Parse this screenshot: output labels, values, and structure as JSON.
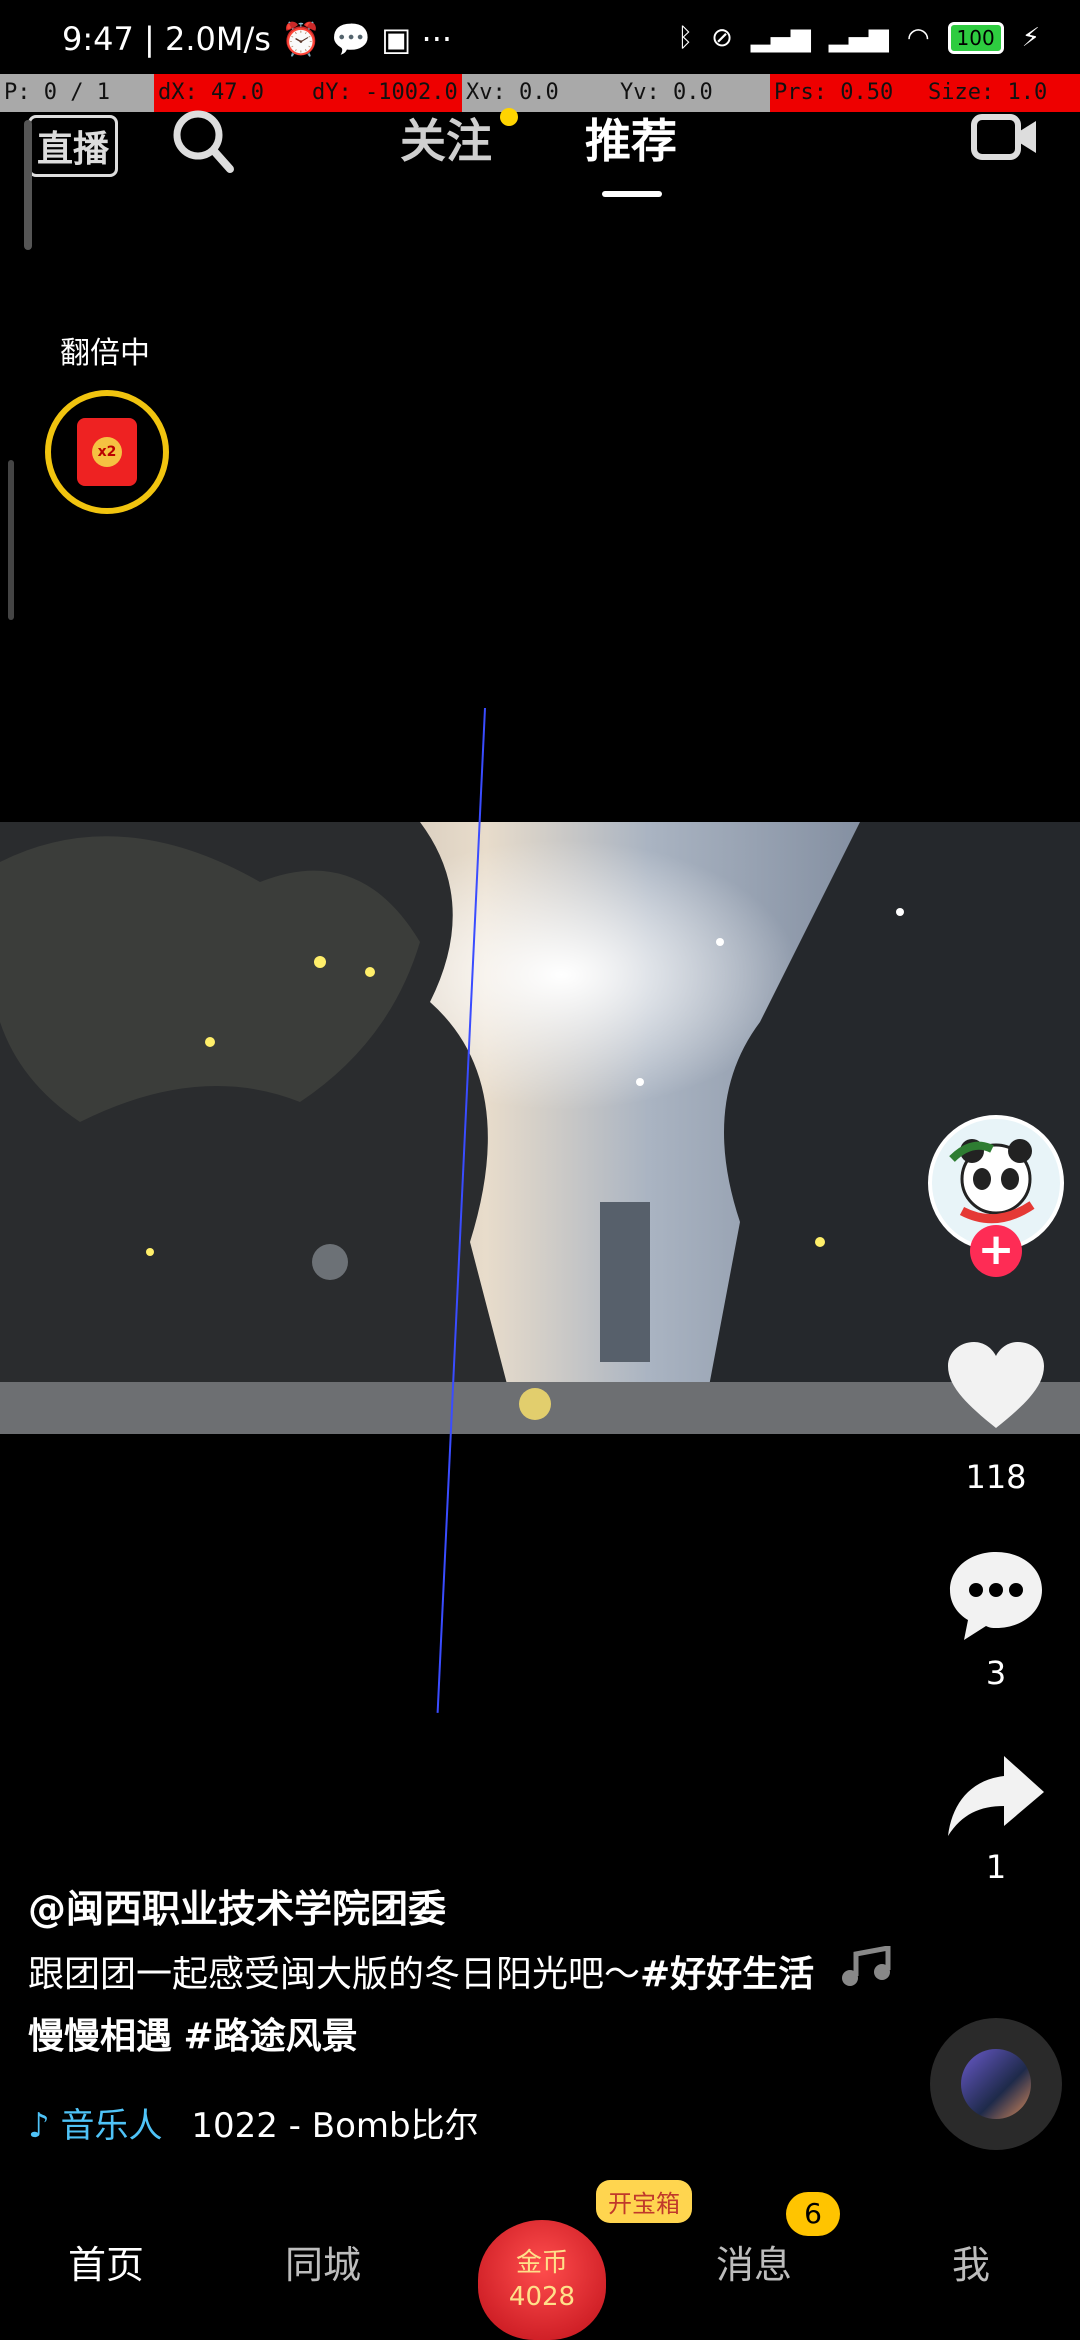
{
  "status_bar": {
    "time": "9:47",
    "speed": "2.0M/s",
    "battery": "100"
  },
  "debug_bar": {
    "p": "P: 0 / 1",
    "dx": "dX: 47.0",
    "dy": "dY: -1002.0",
    "xv": "Xv: 0.0",
    "yv": "Yv: 0.0",
    "prs": "Prs: 0.50",
    "size": "Size: 1.0"
  },
  "top_nav": {
    "live_label": "直播",
    "tab_follow": "关注",
    "tab_recommend": "推荐"
  },
  "reward_widget": {
    "label": "翻倍中",
    "multiplier": "x2"
  },
  "sidebar": {
    "like_count": "118",
    "comment_count": "3",
    "share_count": "1"
  },
  "video_info": {
    "author": "@闽西职业技术学院团委",
    "caption_text": "跟团团一起感受闽大版的冬日阳光吧～",
    "hashtag1": "#好好生活慢慢相遇",
    "hashtag2": "#路途风景",
    "music_label": "音乐人",
    "music_title": "1022 - Bomb比尔"
  },
  "bottom_nav": {
    "home": "首页",
    "local": "同城",
    "chest_tag": "开宝箱",
    "coin_label": "金币",
    "coin_value": "4028",
    "messages": "消息",
    "messages_badge": "6",
    "me": "我"
  },
  "colors": {
    "accent_red": "#fe2c55",
    "music_blue": "#4fc3f7",
    "badge_yellow": "#ffc400"
  }
}
